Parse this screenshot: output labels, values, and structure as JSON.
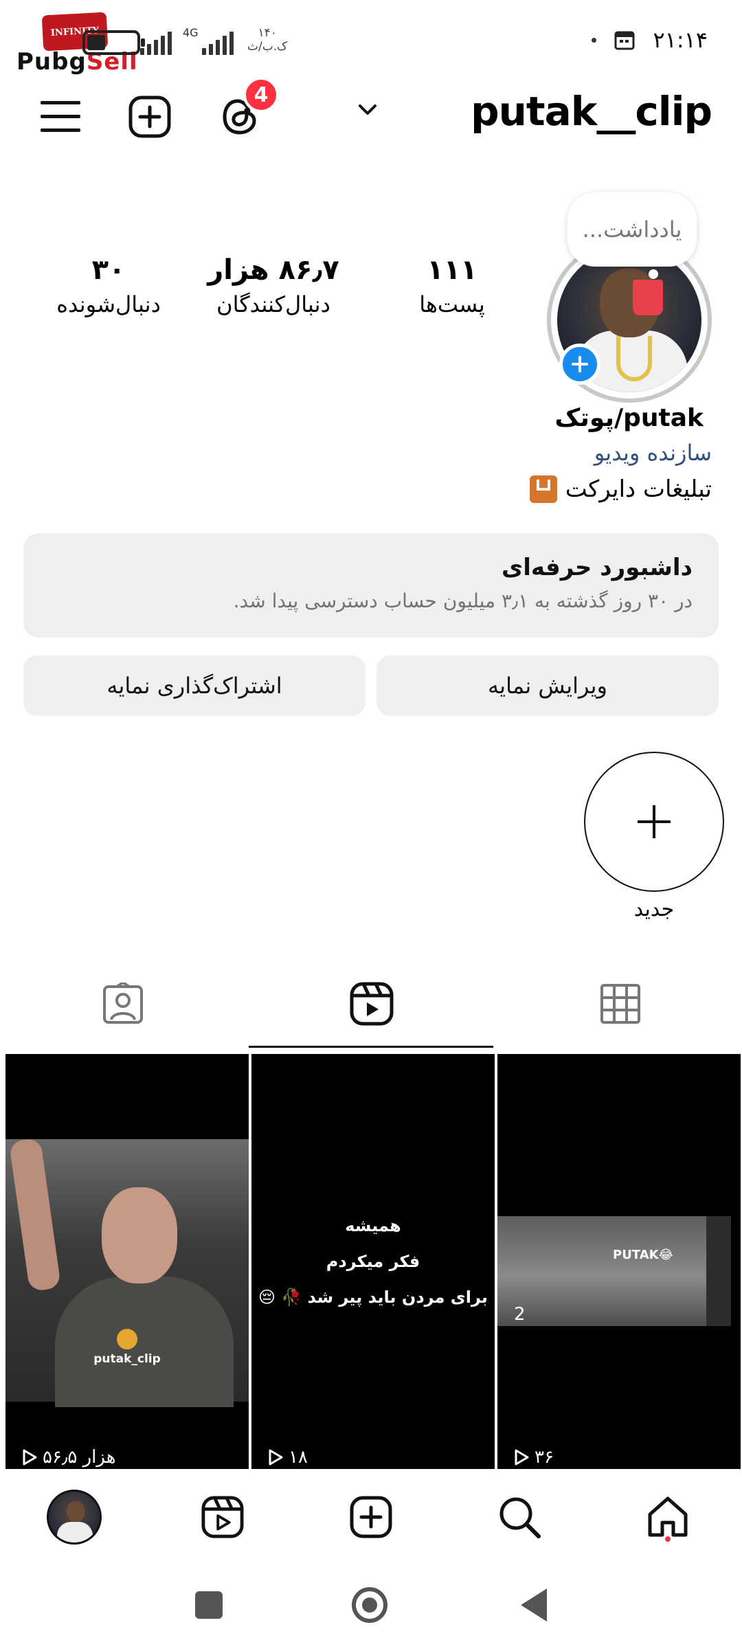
{
  "status_bar": {
    "logo_badge": "INFINITY",
    "logo_text_part1": "Pubg",
    "logo_text_part2": "Sell",
    "network": "4G",
    "speed_value": "۱۴۰",
    "speed_unit": "ک.ب/ث",
    "time": "۲۱:۱۴"
  },
  "header": {
    "username": "putak__clip",
    "notification_count": "4"
  },
  "profile": {
    "note_placeholder": "یادداشت...",
    "stats": [
      {
        "value": "۱۱۱",
        "label": "پست‌ها"
      },
      {
        "value": "۸۶٫۷ هزار",
        "label": "دنبال‌کنندگان"
      },
      {
        "value": "۳۰",
        "label": "دنبال‌شونده"
      }
    ],
    "display_name": "putak/پوتک",
    "category": "سازنده ویدیو",
    "bio": "تبلیغات دایرکت"
  },
  "dashboard": {
    "title": "داشبورد حرفه‌ای",
    "subtitle": "در ۳۰ روز گذشته به ۳٫۱ میلیون حساب دسترسی پیدا شد."
  },
  "buttons": {
    "edit_profile": "ویرایش نمایه",
    "share_profile": "اشتراک‌گذاری نمایه"
  },
  "highlights": {
    "new_label": "جدید"
  },
  "tabs": {
    "active": "reels"
  },
  "posts": [
    {
      "views": "۵۶٫۵ هزار",
      "watermark": "putak_clip"
    },
    {
      "views": "۱۸",
      "lines": [
        "همیشه",
        "فکر میکردم",
        "برای مردن باید پیر شد 🥀 😔"
      ]
    },
    {
      "views": "۳۶",
      "overlay_label": "PUTAK😂",
      "overlay_num": "2"
    }
  ],
  "colors": {
    "badge_red": "#ff3040",
    "story_blue": "#1a8cf0",
    "category_blue": "#33507a"
  },
  "icons": {
    "menu": "hamburger-menu-icon",
    "create": "plus-square-icon",
    "threads": "threads-icon",
    "grid_tab": "grid-icon",
    "reels_tab": "reels-icon",
    "tagged_tab": "tagged-person-icon",
    "nav_home": "home-icon",
    "nav_search": "search-icon",
    "nav_create": "plus-square-icon",
    "nav_reels": "reels-icon"
  }
}
